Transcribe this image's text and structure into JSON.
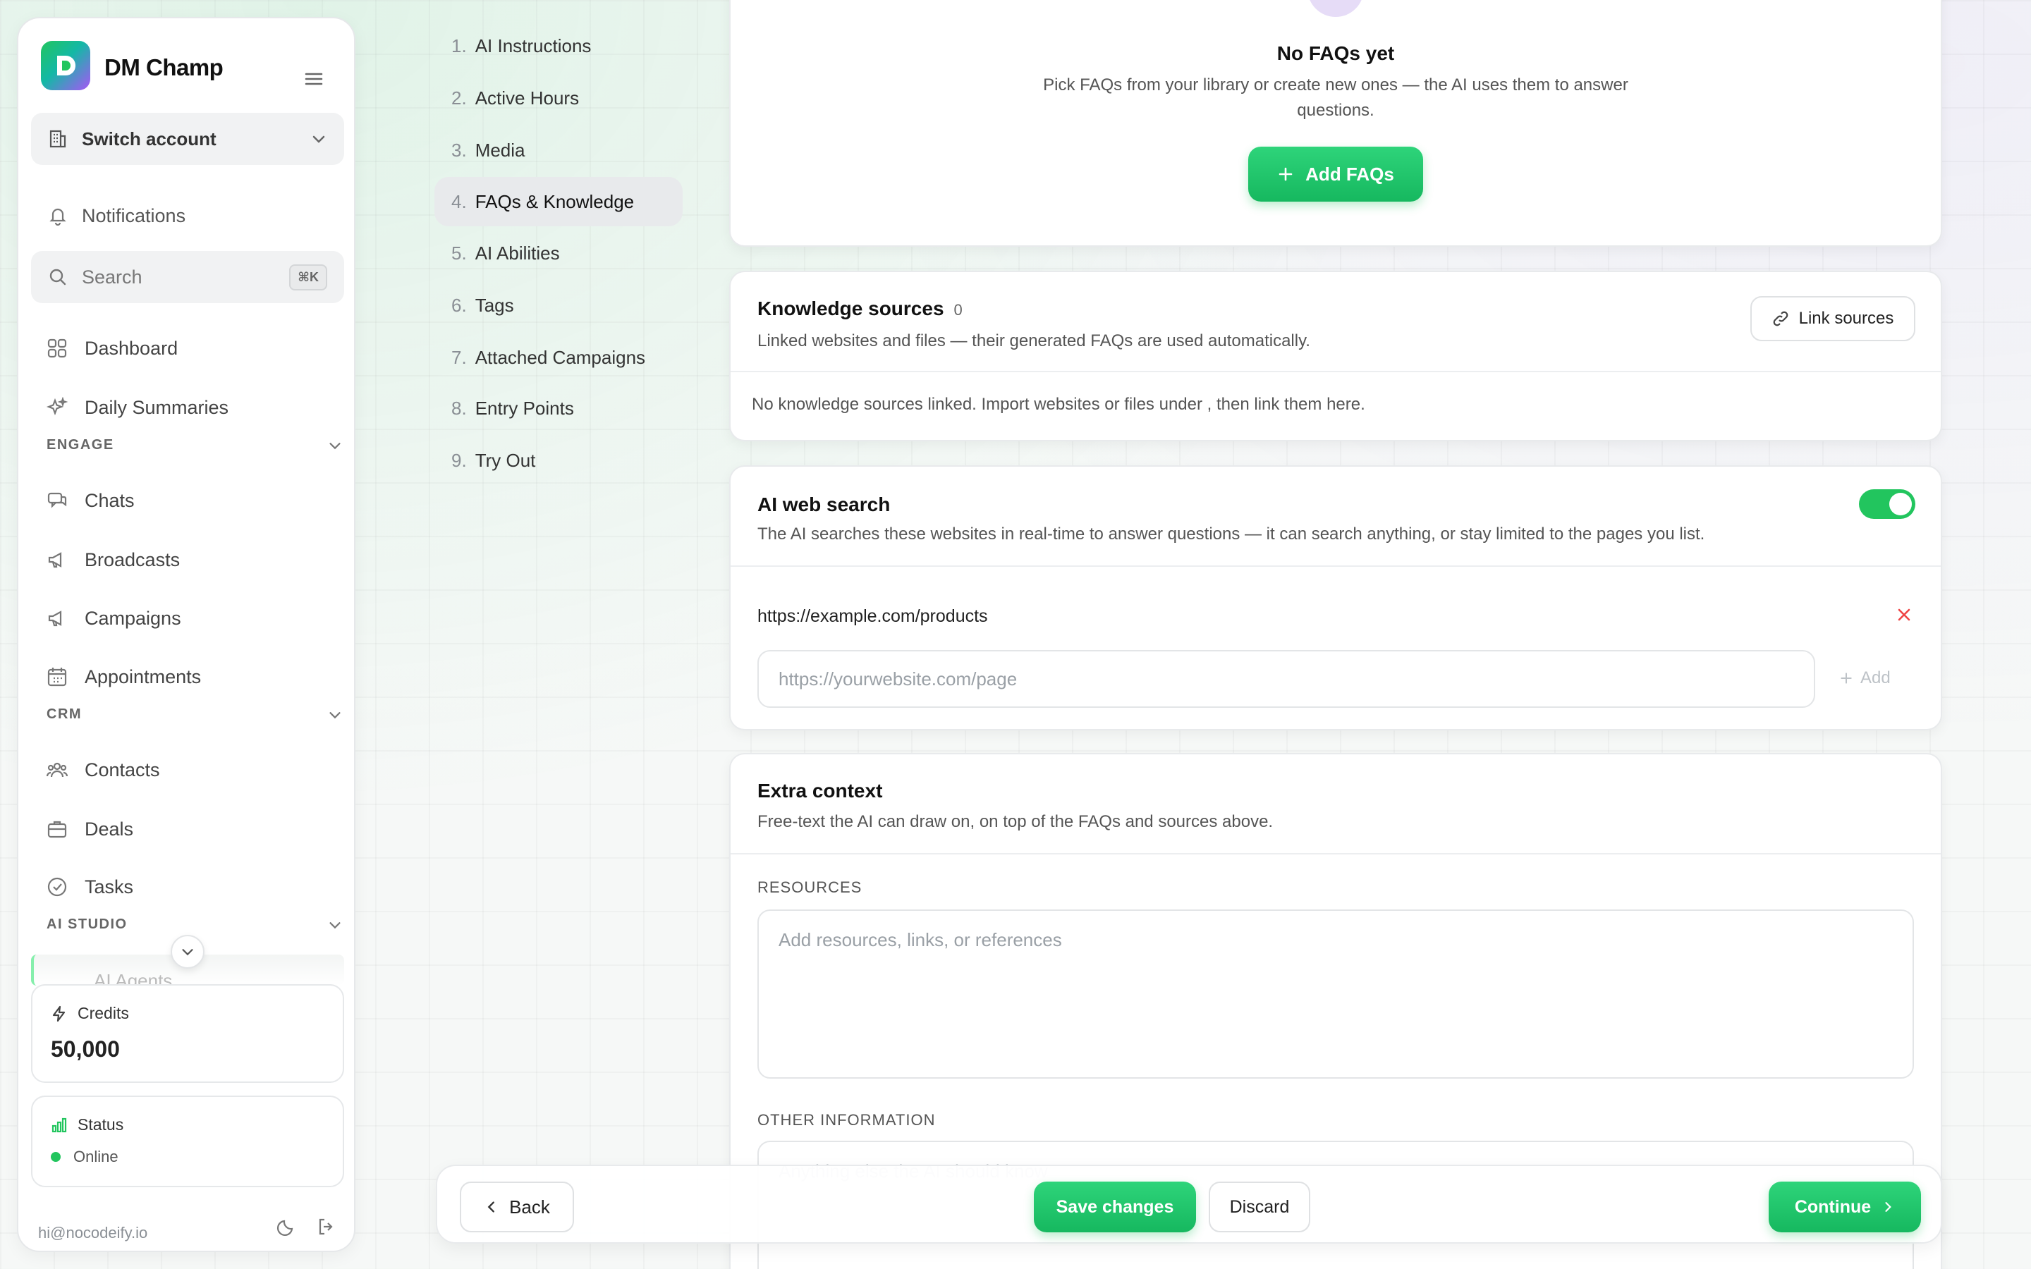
{
  "brand": {
    "name": "DM Champ"
  },
  "sidebar": {
    "switch_account": "Switch account",
    "notifications": "Notifications",
    "search": {
      "label": "Search",
      "shortcut": "⌘K"
    },
    "items": [
      {
        "label": "Dashboard",
        "icon": "grid-icon"
      },
      {
        "label": "Daily Summaries",
        "icon": "sparkles-icon"
      }
    ],
    "engage": {
      "title": "ENGAGE",
      "items": [
        {
          "label": "Chats",
          "icon": "chat-icon"
        },
        {
          "label": "Broadcasts",
          "icon": "megaphone-icon"
        },
        {
          "label": "Campaigns",
          "icon": "megaphone-icon"
        },
        {
          "label": "Appointments",
          "icon": "calendar-icon"
        }
      ]
    },
    "crm": {
      "title": "CRM",
      "items": [
        {
          "label": "Contacts",
          "icon": "users-icon"
        },
        {
          "label": "Deals",
          "icon": "briefcase-icon"
        },
        {
          "label": "Tasks",
          "icon": "check-circle-icon"
        }
      ]
    },
    "ai_studio": {
      "title": "AI STUDIO",
      "faded_item": "AI Agents"
    },
    "credits": {
      "label": "Credits",
      "value": "50,000"
    },
    "status": {
      "label": "Status",
      "value": "Online"
    },
    "footer": {
      "email": "hi@nocodeify.io"
    }
  },
  "steps": [
    {
      "num": "1.",
      "label": "AI Instructions"
    },
    {
      "num": "2.",
      "label": "Active Hours"
    },
    {
      "num": "3.",
      "label": "Media"
    },
    {
      "num": "4.",
      "label": "FAQs & Knowledge"
    },
    {
      "num": "5.",
      "label": "AI Abilities"
    },
    {
      "num": "6.",
      "label": "Tags"
    },
    {
      "num": "7.",
      "label": "Attached Campaigns"
    },
    {
      "num": "8.",
      "label": "Entry Points"
    },
    {
      "num": "9.",
      "label": "Try Out"
    }
  ],
  "faqs": {
    "empty_title": "No FAQs yet",
    "empty_desc_line1": "Pick FAQs from your library or create new ones — the AI uses them to answer",
    "empty_desc_line2": "questions.",
    "add_button": "Add FAQs"
  },
  "knowledge": {
    "title": "Knowledge sources",
    "count": "0",
    "subtitle": "Linked websites and files — their generated FAQs are used automatically.",
    "link_button": "Link sources",
    "empty": "No knowledge sources linked. Import websites or files under , then link them here."
  },
  "web_search": {
    "title": "AI web search",
    "subtitle": "The AI searches these websites in real-time to answer questions — it can search anything, or stay limited to the pages you list.",
    "enabled": true,
    "url": "https://example.com/products",
    "placeholder": "https://yourwebsite.com/page",
    "add_label": "Add"
  },
  "extra_context": {
    "title": "Extra context",
    "subtitle": "Free-text the AI can draw on, on top of the FAQs and sources above.",
    "resources_label": "RESOURCES",
    "resources_placeholder": "Add resources, links, or references",
    "other_label": "OTHER INFORMATION",
    "other_placeholder": "Anything else the AI should know"
  },
  "actions": {
    "back": "Back",
    "save": "Save changes",
    "discard": "Discard",
    "continue": "Continue"
  },
  "colors": {
    "accent": "#22c55e",
    "danger": "#ef4444"
  }
}
